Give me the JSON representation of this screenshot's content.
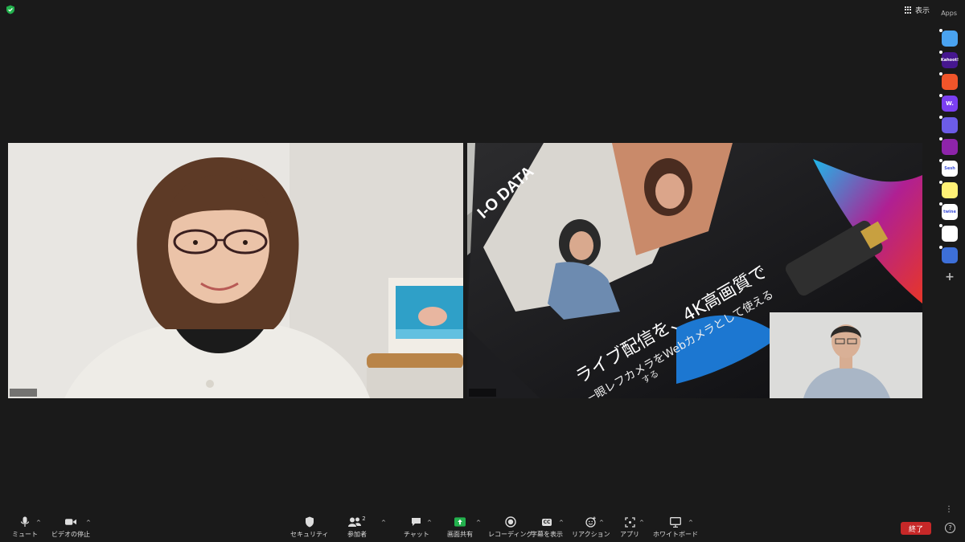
{
  "header": {
    "view_label": "表示",
    "apps_label": "Apps"
  },
  "participants": [
    {
      "name_tag": ""
    },
    {
      "name_tag": ""
    }
  ],
  "shared_screen": {
    "brand": "I-O DATA",
    "headline_1": "ライブ配信を、4K高画質で",
    "headline_2": "一眼レフカメラをWebカメラとして使える",
    "fragment_1": "する",
    "product_brand": "I-O DATA"
  },
  "apps": [
    {
      "name": "arrow-app",
      "color": "#4aa3f0",
      "text": ""
    },
    {
      "name": "kahoot-app",
      "color": "#46178f",
      "text": "Kahoot!"
    },
    {
      "name": "orange-app",
      "color": "#f0552a",
      "text": ""
    },
    {
      "name": "w-app",
      "color": "#7b3ff2",
      "text": "W."
    },
    {
      "name": "headset-app",
      "color": "#6c5ce7",
      "text": ""
    },
    {
      "name": "radar-app",
      "color": "#8e24aa",
      "text": ""
    },
    {
      "name": "sesh-app",
      "color": "#ffffff",
      "text": "Sesh"
    },
    {
      "name": "smiley-app",
      "color": "#fff176",
      "text": ""
    },
    {
      "name": "twine-app",
      "color": "#ffffff",
      "text": "twine"
    },
    {
      "name": "blocks-app",
      "color": "#ffffff",
      "text": ""
    },
    {
      "name": "sync-app",
      "color": "#3d6fd8",
      "text": ""
    }
  ],
  "toolbar": {
    "mute": "ミュート",
    "stop_video": "ビデオの停止",
    "security": "セキュリティ",
    "participants": "参加者",
    "participants_count": "2",
    "chat": "チャット",
    "share_screen": "画面共有",
    "recording": "レコーディング",
    "captions": "字幕を表示",
    "captions_icon": "CC",
    "reactions": "リアクション",
    "apps": "アプリ",
    "whiteboard": "ホワイトボード",
    "end": "終了",
    "help": "?"
  },
  "colors": {
    "accent_share": "#23b14d",
    "end_button": "#c62828"
  }
}
